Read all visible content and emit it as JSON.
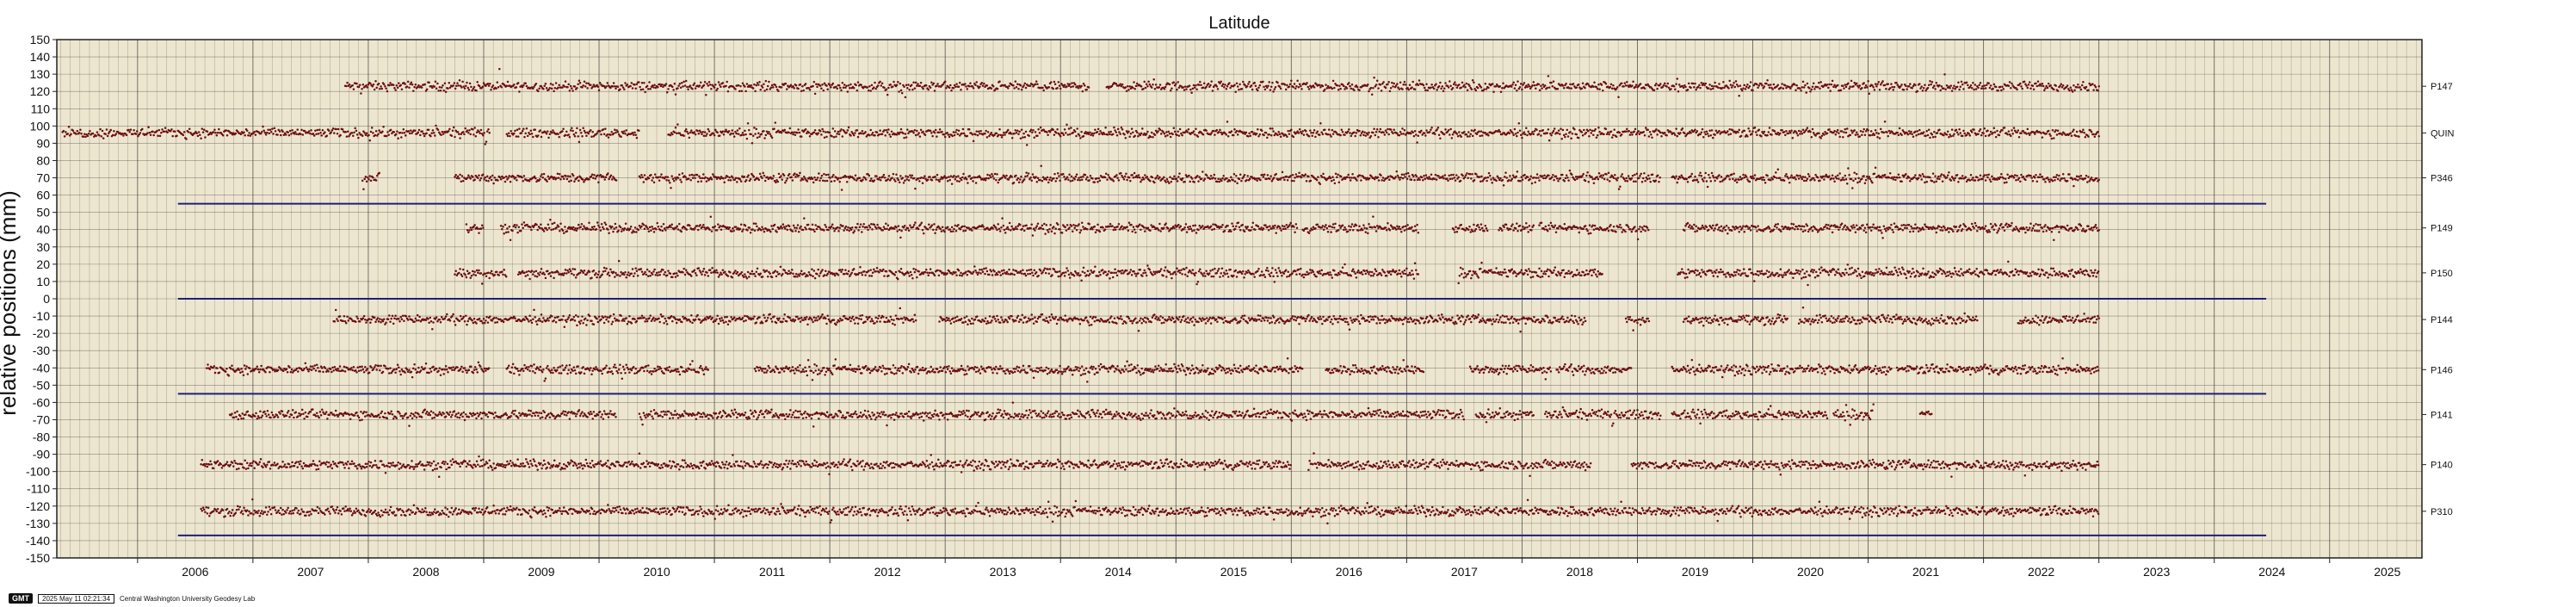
{
  "chart_data": {
    "type": "scatter",
    "title": "Latitude",
    "ylabel": "relative positions (mm)",
    "xlim": [
      2005.3,
      2025.8
    ],
    "ylim": [
      -150,
      150
    ],
    "x_ticks": [
      "2006",
      "2007",
      "2008",
      "2009",
      "2010",
      "2011",
      "2012",
      "2013",
      "2014",
      "2015",
      "2016",
      "2017",
      "2018",
      "2019",
      "2020",
      "2021",
      "2022",
      "2023",
      "2024",
      "2025"
    ],
    "y_ticks": [
      150,
      140,
      130,
      120,
      110,
      100,
      90,
      80,
      70,
      60,
      50,
      40,
      30,
      20,
      10,
      0,
      -10,
      -20,
      -30,
      -40,
      -50,
      -60,
      -70,
      -80,
      -90,
      -100,
      -110,
      -120,
      -130,
      -140,
      -150
    ],
    "grid": true,
    "colors": {
      "background": "#ede6cf",
      "grid": "#3a3a3a",
      "points": "#6b0f12",
      "reference_lines": "#1f1f7a"
    },
    "reference_lines": [
      {
        "y": 55,
        "x": [
          2006.35,
          2024.45
        ]
      },
      {
        "y": 0,
        "x": [
          2006.35,
          2024.45
        ]
      },
      {
        "y": -55,
        "x": [
          2006.35,
          2024.45
        ]
      },
      {
        "y": -137,
        "x": [
          2006.35,
          2024.45
        ]
      }
    ],
    "series": [
      {
        "name": "P147",
        "offset": 123,
        "segments": [
          [
            2007.8,
            2014.25
          ],
          [
            2014.4,
            2023.0
          ]
        ]
      },
      {
        "name": "QUIN",
        "offset": 96,
        "segments": [
          [
            2005.35,
            2009.05
          ],
          [
            2009.2,
            2010.35
          ],
          [
            2010.6,
            2023.0
          ]
        ]
      },
      {
        "name": "P346",
        "offset": 70,
        "segments": [
          [
            2007.95,
            2008.1
          ],
          [
            2008.75,
            2010.15
          ],
          [
            2010.35,
            2019.2
          ],
          [
            2019.3,
            2023.0
          ]
        ]
      },
      {
        "name": "P149",
        "offset": 41,
        "segments": [
          [
            2008.85,
            2009.0
          ],
          [
            2009.15,
            2016.05
          ],
          [
            2016.1,
            2017.1
          ],
          [
            2017.4,
            2017.7
          ],
          [
            2017.8,
            2018.1
          ],
          [
            2018.15,
            2019.1
          ],
          [
            2019.4,
            2023.0
          ]
        ]
      },
      {
        "name": "P150",
        "offset": 15,
        "segments": [
          [
            2008.75,
            2009.2
          ],
          [
            2009.3,
            2017.1
          ],
          [
            2017.45,
            2018.7
          ],
          [
            2019.35,
            2023.0
          ]
        ]
      },
      {
        "name": "P144",
        "offset": -12,
        "segments": [
          [
            2007.7,
            2012.75
          ],
          [
            2012.95,
            2018.55
          ],
          [
            2018.9,
            2019.1
          ],
          [
            2019.4,
            2020.3
          ],
          [
            2020.4,
            2021.95
          ],
          [
            2022.3,
            2023.0
          ]
        ]
      },
      {
        "name": "P146",
        "offset": -41,
        "segments": [
          [
            2006.6,
            2009.05
          ],
          [
            2009.2,
            2010.95
          ],
          [
            2011.35,
            2016.1
          ],
          [
            2016.3,
            2017.15
          ],
          [
            2017.55,
            2018.25
          ],
          [
            2018.3,
            2018.95
          ],
          [
            2019.3,
            2021.2
          ],
          [
            2021.25,
            2023.0
          ]
        ]
      },
      {
        "name": "P141",
        "offset": -67,
        "segments": [
          [
            2006.8,
            2010.15
          ],
          [
            2010.35,
            2017.5
          ],
          [
            2017.6,
            2018.1
          ],
          [
            2018.2,
            2019.2
          ],
          [
            2019.3,
            2020.65
          ],
          [
            2020.7,
            2021.05
          ],
          [
            2021.45,
            2021.55
          ]
        ]
      },
      {
        "name": "P140",
        "offset": -96,
        "segments": [
          [
            2006.55,
            2016.0
          ],
          [
            2016.15,
            2018.6
          ],
          [
            2018.95,
            2023.0
          ]
        ]
      },
      {
        "name": "P310",
        "offset": -123,
        "segments": [
          [
            2006.55,
            2023.0
          ]
        ]
      }
    ]
  },
  "footer": {
    "logo": "GMT",
    "timestamp": "2025 May 11 02:21:34",
    "credit": "Central Washington University Geodesy Lab"
  }
}
